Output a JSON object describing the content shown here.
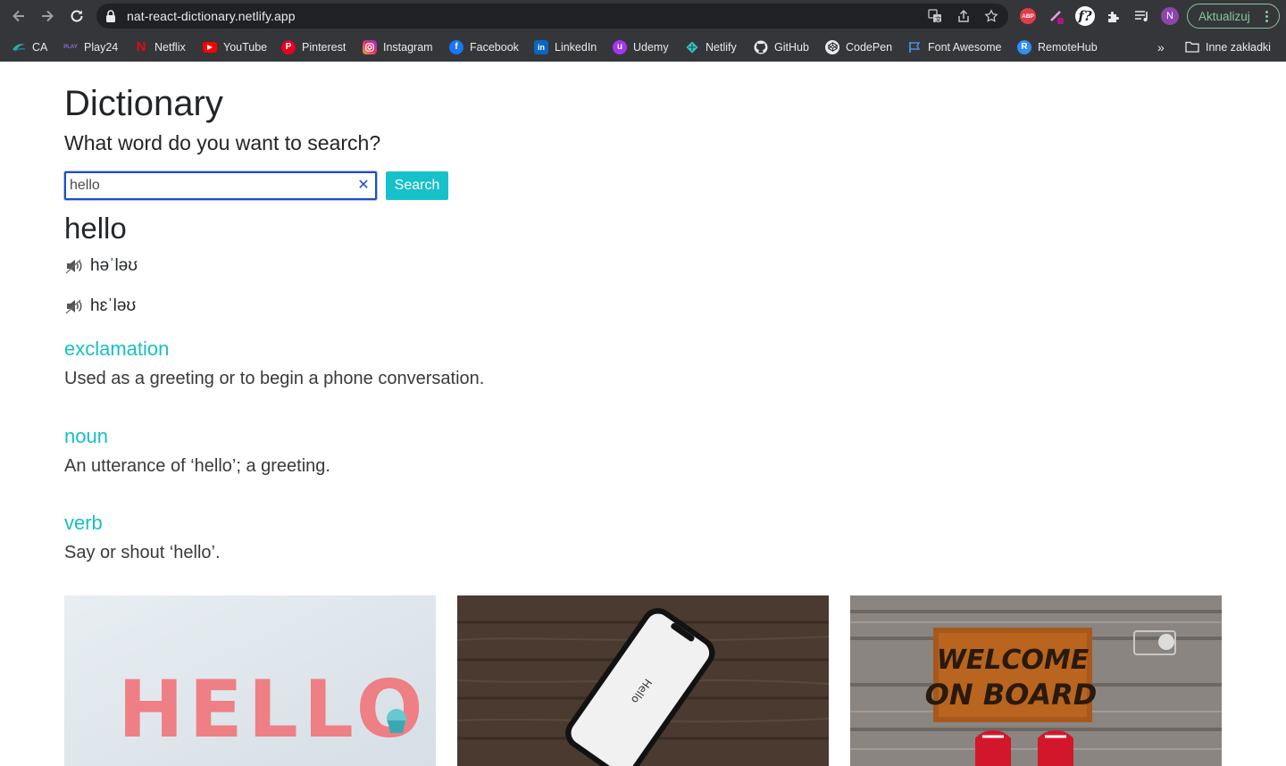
{
  "browser": {
    "url": "nat-react-dictionary.netlify.app",
    "profile_initial": "N",
    "update_label": "Aktualizuj",
    "abp_label": "ABP",
    "bookmarks": [
      {
        "label": "CA",
        "icon": "ca-icon"
      },
      {
        "label": "Play24",
        "icon": "play24-icon"
      },
      {
        "label": "Netflix",
        "icon": "netflix-icon"
      },
      {
        "label": "YouTube",
        "icon": "youtube-icon"
      },
      {
        "label": "Pinterest",
        "icon": "pinterest-icon"
      },
      {
        "label": "Instagram",
        "icon": "instagram-icon"
      },
      {
        "label": "Facebook",
        "icon": "facebook-icon"
      },
      {
        "label": "LinkedIn",
        "icon": "linkedin-icon"
      },
      {
        "label": "Udemy",
        "icon": "udemy-icon"
      },
      {
        "label": "Netlify",
        "icon": "netlify-icon"
      },
      {
        "label": "GitHub",
        "icon": "github-icon"
      },
      {
        "label": "CodePen",
        "icon": "codepen-icon"
      },
      {
        "label": "Font Awesome",
        "icon": "font-awesome-icon"
      },
      {
        "label": "RemoteHub",
        "icon": "remotehub-icon"
      }
    ],
    "more_bookmarks": "»",
    "other_bookmarks": "Inne zakładki"
  },
  "app": {
    "title": "Dictionary",
    "prompt": "What word do you want to search?",
    "search_value": "hello",
    "search_button": "Search",
    "word": "hello",
    "phonetics": [
      "həˈləʊ",
      "hɛˈləʊ"
    ],
    "meanings": [
      {
        "part_of_speech": "exclamation",
        "definition": "Used as a greeting or to begin a phone conversation."
      },
      {
        "part_of_speech": "noun",
        "definition": "An utterance of ‘hello’; a greeting."
      },
      {
        "part_of_speech": "verb",
        "definition": "Say or shout ‘hello’."
      }
    ],
    "photos": [
      {
        "name": "hello-letters-photo",
        "caption": "HELLO"
      },
      {
        "name": "phone-hello-photo",
        "caption": "Hello"
      },
      {
        "name": "welcome-mat-photo",
        "caption": "WELCOME ON BOARD"
      }
    ]
  },
  "colors": {
    "accent": "#17c1c9",
    "chrome": "#35363a",
    "omnibox": "#202124",
    "update_green": "#81c995"
  }
}
